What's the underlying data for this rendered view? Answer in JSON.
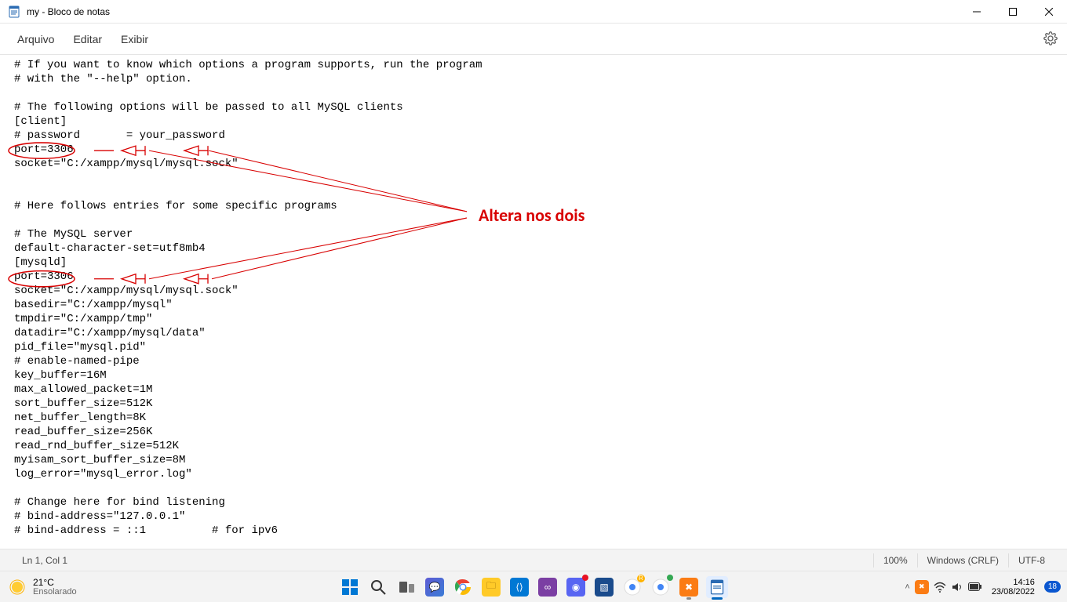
{
  "titlebar": {
    "title": "my - Bloco de notas"
  },
  "menu": {
    "file": "Arquivo",
    "edit": "Editar",
    "view": "Exibir"
  },
  "editor_text": "# If you want to know which options a program supports, run the program\n# with the \"--help\" option.\n\n# The following options will be passed to all MySQL clients\n[client]\n# password       = your_password\nport=3306\nsocket=\"C:/xampp/mysql/mysql.sock\"\n\n\n# Here follows entries for some specific programs\n\n# The MySQL server\ndefault-character-set=utf8mb4\n[mysqld]\nport=3306\nsocket=\"C:/xampp/mysql/mysql.sock\"\nbasedir=\"C:/xampp/mysql\"\ntmpdir=\"C:/xampp/tmp\"\ndatadir=\"C:/xampp/mysql/data\"\npid_file=\"mysql.pid\"\n# enable-named-pipe\nkey_buffer=16M\nmax_allowed_packet=1M\nsort_buffer_size=512K\nnet_buffer_length=8K\nread_buffer_size=256K\nread_rnd_buffer_size=512K\nmyisam_sort_buffer_size=8M\nlog_error=\"mysql_error.log\"\n\n# Change here for bind listening\n# bind-address=\"127.0.0.1\"\n# bind-address = ::1          # for ipv6",
  "annotation": {
    "label": "Altera nos dois",
    "color": "#d80000"
  },
  "status": {
    "pos": "Ln 1, Col 1",
    "zoom": "100%",
    "lineend": "Windows (CRLF)",
    "encoding": "UTF-8"
  },
  "weather": {
    "temp": "21°C",
    "cond": "Ensolarado"
  },
  "clock": {
    "time": "14:16",
    "date": "23/08/2022"
  },
  "tray_badge": "18"
}
